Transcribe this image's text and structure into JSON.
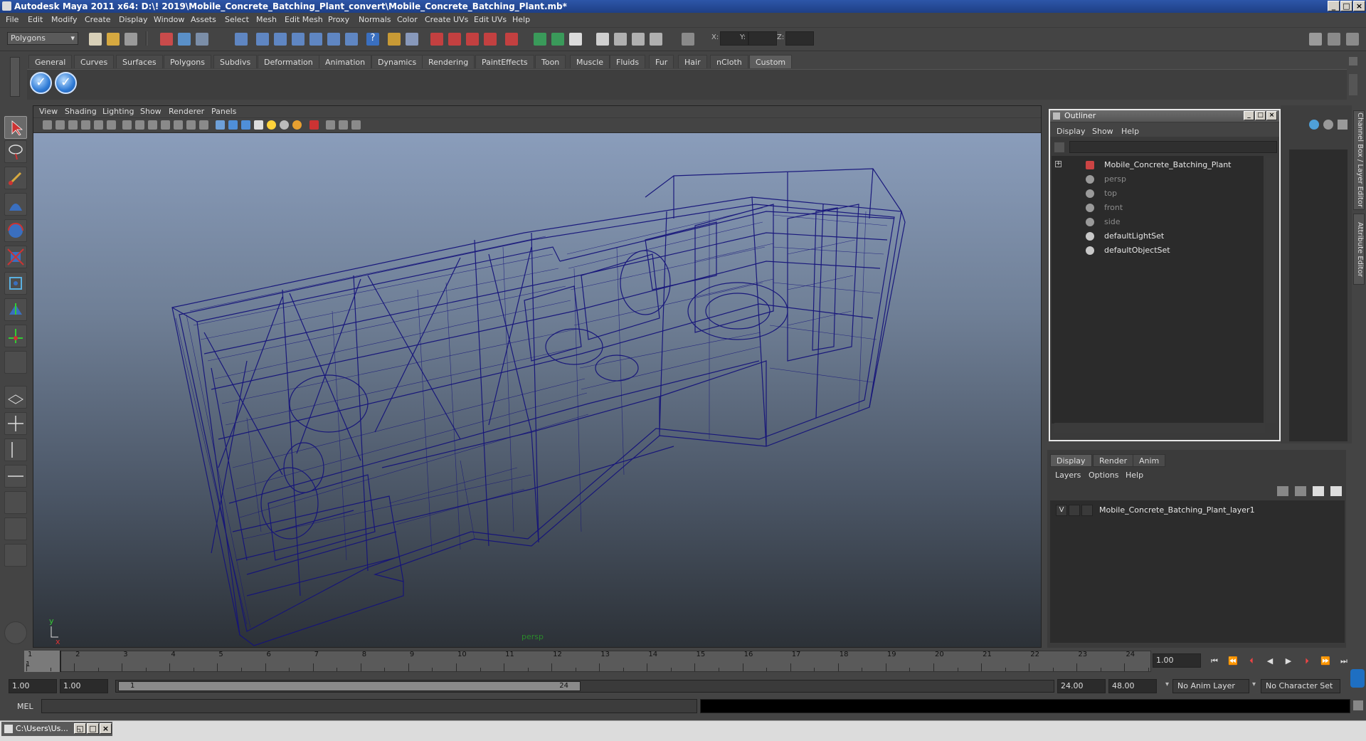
{
  "window": {
    "title": "Autodesk Maya 2011 x64: D:\\! 2019\\Mobile_Concrete_Batching_Plant_convert\\Mobile_Concrete_Batching_Plant.mb*"
  },
  "menubar": [
    "File",
    "Edit",
    "Modify",
    "Create",
    "Display",
    "Window",
    "Assets",
    "Select",
    "Mesh",
    "Edit Mesh",
    "Proxy",
    "Normals",
    "Color",
    "Create UVs",
    "Edit UVs",
    "Help"
  ],
  "statusline": {
    "mode": "Polygons",
    "coords": {
      "x_label": "X:",
      "y_label": "Y:",
      "z_label": "Z:"
    }
  },
  "shelf": {
    "tabs": [
      "General",
      "Curves",
      "Surfaces",
      "Polygons",
      "Subdivs",
      "Deformation",
      "Animation",
      "Dynamics",
      "Rendering",
      "PaintEffects",
      "Toon",
      "Muscle",
      "Fluids",
      "Fur",
      "Hair",
      "nCloth",
      "Custom"
    ],
    "active_tab": "Custom"
  },
  "viewport": {
    "menus": [
      "View",
      "Shading",
      "Lighting",
      "Show",
      "Renderer",
      "Panels"
    ],
    "camera_label": "persp",
    "axis": {
      "y": "y",
      "x": "x"
    },
    "wireframe_color": "#15137a"
  },
  "outliner": {
    "title": "Outliner",
    "menus": [
      "Display",
      "Show",
      "Help"
    ],
    "items": [
      {
        "label": "Mobile_Concrete_Batching_Plant",
        "icon": "mesh-group-icon",
        "dim": false,
        "expandable": true
      },
      {
        "label": "persp",
        "icon": "camera-icon",
        "dim": true
      },
      {
        "label": "top",
        "icon": "camera-icon",
        "dim": true
      },
      {
        "label": "front",
        "icon": "camera-icon",
        "dim": true
      },
      {
        "label": "side",
        "icon": "camera-icon",
        "dim": true
      },
      {
        "label": "defaultLightSet",
        "icon": "set-icon",
        "dim": false
      },
      {
        "label": "defaultObjectSet",
        "icon": "set-icon",
        "dim": false
      }
    ]
  },
  "side_tabs": [
    "Channel Box / Layer Editor",
    "Attribute Editor"
  ],
  "layer_editor": {
    "tabs": [
      "Display",
      "Render",
      "Anim"
    ],
    "active_tab": "Display",
    "menus": [
      "Layers",
      "Options",
      "Help"
    ],
    "layers": [
      {
        "visible": "V",
        "name": "Mobile_Concrete_Batching_Plant_layer1"
      }
    ]
  },
  "timeslider": {
    "ticks": [
      "1",
      "2",
      "3",
      "4",
      "5",
      "6",
      "7",
      "8",
      "9",
      "10",
      "11",
      "12",
      "13",
      "14",
      "15",
      "16",
      "17",
      "18",
      "19",
      "20",
      "21",
      "22",
      "23",
      "24"
    ],
    "current_frame_marker": "1",
    "current_frame": "1.00"
  },
  "rangeslider": {
    "start_time": "1.00",
    "playback_start": "1.00",
    "range_start_label": "1",
    "range_end_label": "24",
    "playback_end": "24.00",
    "end_time": "48.00",
    "anim_layer": "No Anim Layer",
    "character_set": "No Character Set"
  },
  "commandline": {
    "label": "MEL"
  },
  "taskbar": {
    "item": "C:\\Users\\Us..."
  }
}
